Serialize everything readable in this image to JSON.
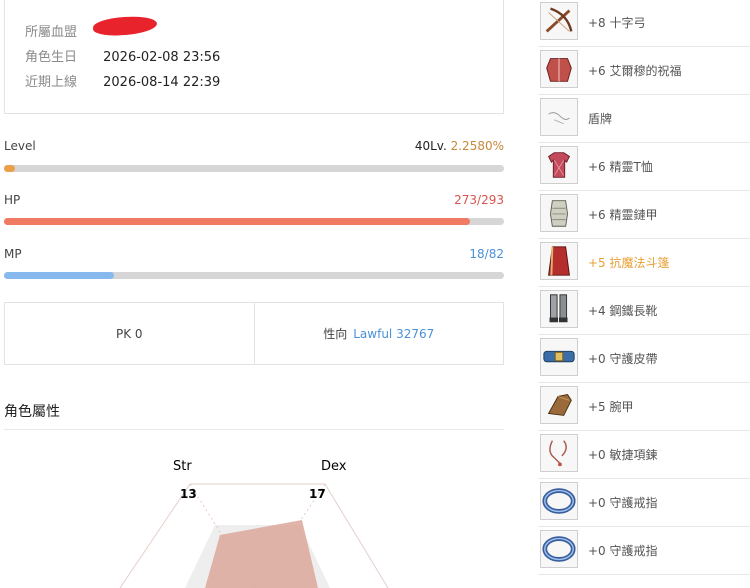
{
  "info": {
    "clan_label": "所屬血盟",
    "birthday_label": "角色生日",
    "birthday_value": "2026-02-08 23:56",
    "last_login_label": "近期上線",
    "last_login_value": "2026-08-14 22:39"
  },
  "stats": {
    "level": {
      "label": "Level",
      "value_main": "40Lv.",
      "value_pct": "2.2580%",
      "fill": 0.02258,
      "color": "#e8a04a"
    },
    "hp": {
      "label": "HP",
      "value": "273/293",
      "fill": 0.9317,
      "color": "#f07a63"
    },
    "mp": {
      "label": "MP",
      "value": "18/82",
      "fill": 0.2195,
      "color": "#88b9ee"
    }
  },
  "pk": {
    "pk_text": "PK 0",
    "alignment_label": "性向",
    "alignment_value": "Lawful 32767"
  },
  "attributes": {
    "title": "角色屬性",
    "str_label": "Str",
    "str_value": "13",
    "dex_label": "Dex",
    "dex_value": "17"
  },
  "equipment": [
    {
      "name": "+8 十字弓",
      "icon": "crossbow-icon",
      "highlight": false
    },
    {
      "name": "+6 艾爾穆的祝福",
      "icon": "chest-armor-icon",
      "highlight": false
    },
    {
      "name": "盾牌",
      "icon": "shield-sketch-icon",
      "highlight": false
    },
    {
      "name": "+6 精靈T恤",
      "icon": "tshirt-icon",
      "highlight": false
    },
    {
      "name": "+6 精靈鏈甲",
      "icon": "chainmail-icon",
      "highlight": false
    },
    {
      "name": "+5 抗魔法斗篷",
      "icon": "cloak-icon",
      "highlight": true
    },
    {
      "name": "+4 鋼鐵長靴",
      "icon": "boots-icon",
      "highlight": false
    },
    {
      "name": "+0 守護皮帶",
      "icon": "belt-icon",
      "highlight": false
    },
    {
      "name": "+5 腕甲",
      "icon": "gauntlet-icon",
      "highlight": false
    },
    {
      "name": "+0 敏捷項鍊",
      "icon": "necklace-icon",
      "highlight": false
    },
    {
      "name": "+0 守護戒指",
      "icon": "ring-icon",
      "highlight": false
    },
    {
      "name": "+0 守護戒指",
      "icon": "ring-icon",
      "highlight": false
    }
  ],
  "colors": {
    "accent_blue": "#4a90d9",
    "level_pct": "#c48a3a",
    "hp_value": "#d9534f",
    "highlight": "#e8a035"
  }
}
